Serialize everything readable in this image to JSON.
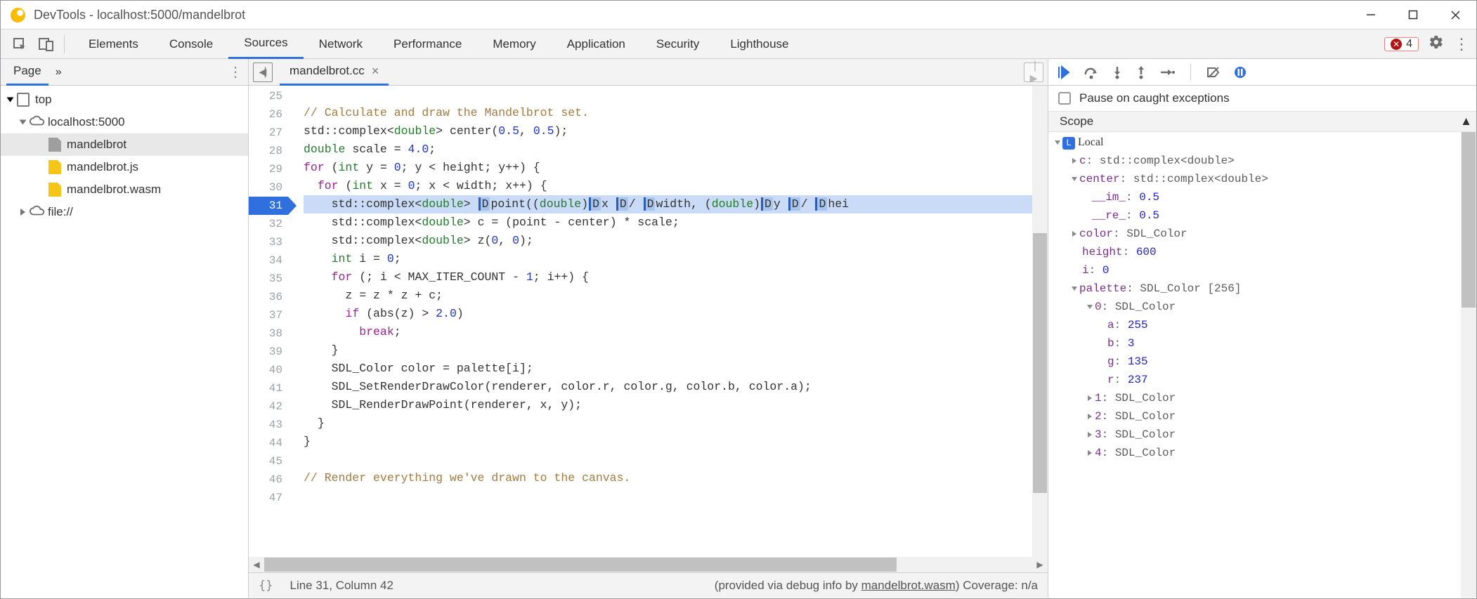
{
  "title": "DevTools - localhost:5000/mandelbrot",
  "errors": "4",
  "tabs": [
    "Elements",
    "Console",
    "Sources",
    "Network",
    "Performance",
    "Memory",
    "Application",
    "Security",
    "Lighthouse"
  ],
  "active_tab": "Sources",
  "page_tab": "Page",
  "overflow": "»",
  "tree": {
    "top": "top",
    "host": "localhost:5000",
    "f1": "mandelbrot",
    "f2": "mandelbrot.js",
    "f3": "mandelbrot.wasm",
    "f4": "file://"
  },
  "file_name": "mandelbrot.cc",
  "line_numbers": [
    "25",
    "26",
    "27",
    "28",
    "29",
    "30",
    "31",
    "32",
    "33",
    "34",
    "35",
    "36",
    "37",
    "38",
    "39",
    "40",
    "41",
    "42",
    "43",
    "44",
    "45",
    "46",
    "47"
  ],
  "code": {
    "l25": "",
    "l26_p1": "// Calculate and draw the Mandelbrot set.",
    "l27_p1": "std::complex<",
    "l27_p2": "double",
    "l27_p3": "> center(",
    "l27_p4": "0.5",
    "l27_p5": ", ",
    "l27_p6": "0.5",
    "l27_p7": ");",
    "l28_p1": "double",
    "l28_p2": " scale = ",
    "l28_p3": "4.0",
    "l28_p4": ";",
    "l29_p1": "for",
    "l29_p2": " (",
    "l29_p3": "int",
    "l29_p4": " y = ",
    "l29_p5": "0",
    "l29_p6": "; y < height; y++) {",
    "l30_p1": "for",
    "l30_p2": " (",
    "l30_p3": "int",
    "l30_p4": " x = ",
    "l30_p5": "0",
    "l30_p6": "; x < width; x++) {",
    "l31_p1": "std::complex<",
    "l31_p2": "double",
    "l31_p3": "> ",
    "l31_d1": "D",
    "l31_p4": "point((",
    "l31_p5": "double",
    "l31_p6": ")",
    "l31_d2": "D",
    "l31_p7": "x ",
    "l31_d3": "D",
    "l31_p8": "/ ",
    "l31_d4": "D",
    "l31_p9": "width, (",
    "l31_p10": "double",
    "l31_p11": ")",
    "l31_d5": "D",
    "l31_p12": "y ",
    "l31_d6": "D",
    "l31_p13": "/ ",
    "l31_d7": "D",
    "l31_p14": "hei",
    "l32": "std::complex<",
    "l32b": "double",
    "l32c": "> c = (point - center) * scale;",
    "l33": "std::complex<",
    "l33b": "double",
    "l33c": "> z(",
    "l33d": "0",
    "l33e": ", ",
    "l33f": "0",
    "l33g": ");",
    "l34a": "int",
    "l34b": " i = ",
    "l34c": "0",
    "l34d": ";",
    "l35a": "for",
    "l35b": " (; i < MAX_ITER_COUNT - ",
    "l35c": "1",
    "l35d": "; i++) {",
    "l36": "z = z * z + c;",
    "l37a": "if",
    "l37b": " (abs(z) > ",
    "l37c": "2.0",
    "l37d": ")",
    "l38a": "break",
    "l38b": ";",
    "l39": "}",
    "l40": "SDL_Color color = palette[i];",
    "l41": "SDL_SetRenderDrawColor(renderer, color.r, color.g, color.b, color.a);",
    "l42": "SDL_RenderDrawPoint(renderer, x, y);",
    "l43": "}",
    "l44": "}",
    "l45": "",
    "l46": "// Render everything we've drawn to the canvas."
  },
  "status": {
    "brace": "{}",
    "pos": "Line 31, Column 42",
    "prov1": "(provided via debug info by ",
    "prov_link": "mandelbrot.wasm",
    "prov2": ")",
    "cov": " Coverage: n/a"
  },
  "pause_caught": "Pause on caught exceptions",
  "scope_header": "Scope",
  "scope": {
    "local": "Local",
    "c_k": "c",
    "c_v": ": std::complex<double>",
    "center_k": "center",
    "center_v": ": std::complex<double>",
    "im_k": "__im_",
    "im_v": "0.5",
    "re_k": "__re_",
    "re_v": "0.5",
    "color_k": "color",
    "color_v": ": SDL_Color",
    "height_k": "height",
    "height_v": "600",
    "i_k": "i",
    "i_v": "0",
    "palette_k": "palette",
    "palette_v": ": SDL_Color [256]",
    "p0_k": "0",
    "p0_v": ": SDL_Color",
    "pa_k": "a",
    "pa_v": "255",
    "pb_k": "b",
    "pb_v": "3",
    "pg_k": "g",
    "pg_v": "135",
    "pr_k": "r",
    "pr_v": "237",
    "p1_k": "1",
    "p1_v": ": SDL_Color",
    "p2_k": "2",
    "p2_v": ": SDL_Color",
    "p3_k": "3",
    "p3_v": ": SDL_Color",
    "p4_k": "4",
    "p4_v": ": SDL_Color"
  }
}
